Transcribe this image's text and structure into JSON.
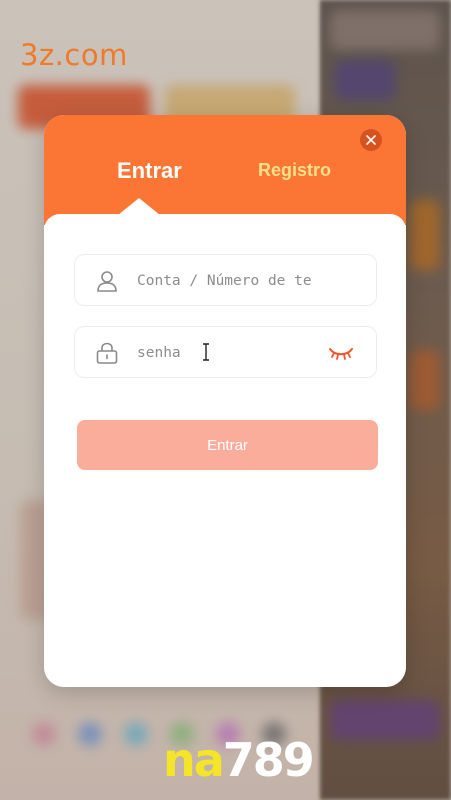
{
  "site_label": "3z.com",
  "modal": {
    "tabs": {
      "login": "Entrar",
      "register": "Registro"
    },
    "account_field": {
      "placeholder": "Conta / Número de te",
      "value": ""
    },
    "password_field": {
      "placeholder": "senha",
      "value": ""
    },
    "submit_label": "Entrar"
  },
  "watermark": {
    "part1": "na",
    "part2": "789"
  },
  "icons": {
    "close": "close-icon",
    "account": "user-icon",
    "password": "lock-icon",
    "visibility": "eye-closed-icon",
    "cursor": "text-cursor-icon"
  },
  "colors": {
    "accent": "#fb7634",
    "close_bg": "#d6531f",
    "register_tab": "#ffe08a",
    "submit_bg": "#f9ad9a",
    "eye": "#f0552a",
    "watermark_yellow": "#f5e528"
  }
}
